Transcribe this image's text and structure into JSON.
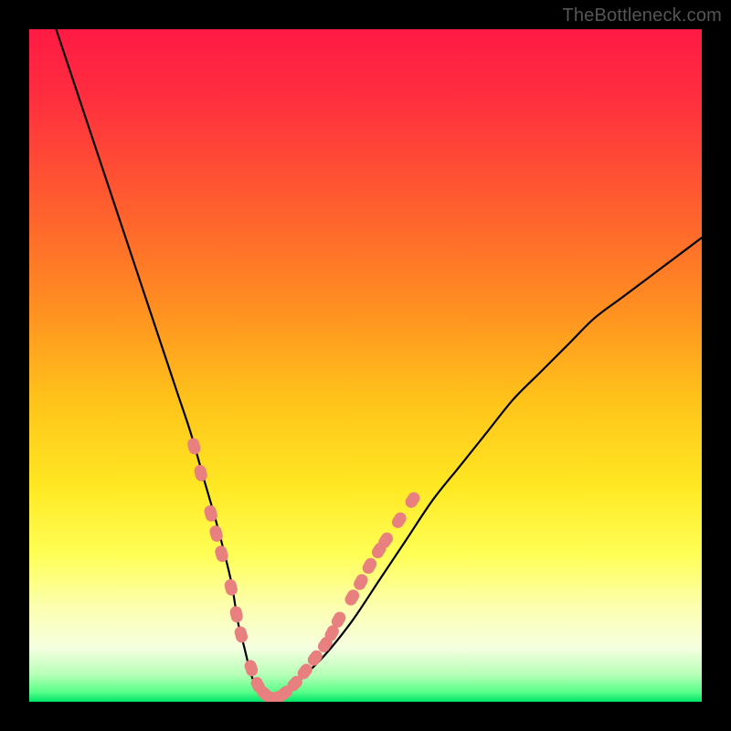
{
  "watermark": "TheBottleneck.com",
  "colors": {
    "frame": "#000000",
    "gradient_stops": [
      {
        "offset": 0.0,
        "color": "#ff1a44"
      },
      {
        "offset": 0.1,
        "color": "#ff2e3f"
      },
      {
        "offset": 0.25,
        "color": "#ff5a30"
      },
      {
        "offset": 0.4,
        "color": "#ff8a22"
      },
      {
        "offset": 0.55,
        "color": "#ffc21a"
      },
      {
        "offset": 0.68,
        "color": "#ffe823"
      },
      {
        "offset": 0.78,
        "color": "#ffff55"
      },
      {
        "offset": 0.86,
        "color": "#fcffb0"
      },
      {
        "offset": 0.92,
        "color": "#f5ffe0"
      },
      {
        "offset": 0.96,
        "color": "#b6ffb6"
      },
      {
        "offset": 0.985,
        "color": "#5aff8a"
      },
      {
        "offset": 1.0,
        "color": "#00e56a"
      }
    ],
    "curve": "#000000",
    "marker_fill": "#e98080",
    "marker_stroke": "#d46a6a"
  },
  "chart_data": {
    "type": "line",
    "title": "",
    "xlabel": "",
    "ylabel": "",
    "xlim": [
      0,
      100
    ],
    "ylim": [
      0,
      100
    ],
    "series": [
      {
        "name": "bottleneck-curve",
        "x": [
          4,
          6,
          8,
          10,
          12,
          14,
          16,
          18,
          20,
          22,
          24,
          26,
          28,
          30,
          31,
          32,
          33,
          34,
          35,
          36,
          38,
          40,
          44,
          48,
          52,
          56,
          60,
          64,
          68,
          72,
          76,
          80,
          84,
          88,
          92,
          96,
          100
        ],
        "values": [
          100,
          94,
          88,
          82,
          76,
          70,
          64,
          58,
          52,
          46,
          40,
          33,
          26,
          18,
          12,
          8,
          4,
          2,
          1,
          0,
          1,
          3,
          7,
          12,
          18,
          24,
          30,
          35,
          40,
          45,
          49,
          53,
          57,
          60,
          63,
          66,
          69
        ]
      }
    ],
    "markers": {
      "name": "highlight-segments",
      "points": [
        {
          "x": 24.5,
          "y": 38
        },
        {
          "x": 25.5,
          "y": 34
        },
        {
          "x": 27.0,
          "y": 28
        },
        {
          "x": 27.8,
          "y": 25
        },
        {
          "x": 28.6,
          "y": 22
        },
        {
          "x": 30.0,
          "y": 17
        },
        {
          "x": 30.8,
          "y": 13
        },
        {
          "x": 31.5,
          "y": 10
        },
        {
          "x": 33.0,
          "y": 5
        },
        {
          "x": 34.0,
          "y": 2.5
        },
        {
          "x": 35.0,
          "y": 1.2
        },
        {
          "x": 36.0,
          "y": 0.6
        },
        {
          "x": 37.0,
          "y": 0.7
        },
        {
          "x": 38.0,
          "y": 1.3
        },
        {
          "x": 39.5,
          "y": 2.7
        },
        {
          "x": 41.0,
          "y": 4.5
        },
        {
          "x": 42.5,
          "y": 6.5
        },
        {
          "x": 44.0,
          "y": 8.5
        },
        {
          "x": 45.0,
          "y": 10.2
        },
        {
          "x": 46.0,
          "y": 12.2
        },
        {
          "x": 48.0,
          "y": 15.5
        },
        {
          "x": 49.3,
          "y": 17.8
        },
        {
          "x": 50.6,
          "y": 20.2
        },
        {
          "x": 52.0,
          "y": 22.5
        },
        {
          "x": 53.0,
          "y": 24.0
        },
        {
          "x": 55.0,
          "y": 27.0
        },
        {
          "x": 57.0,
          "y": 30.0
        }
      ]
    }
  }
}
